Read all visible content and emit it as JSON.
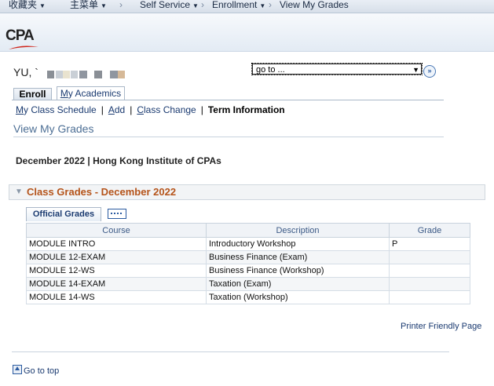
{
  "topnav": {
    "favorites": "收藏夹",
    "main_menu": "主菜单",
    "self_service": "Self Service",
    "enrollment": "Enrollment",
    "current": "View My Grades"
  },
  "header": {
    "logo": "CPA",
    "logo_color": "#222222",
    "swoosh_color": "#d0271d"
  },
  "student": {
    "name": "YU, `"
  },
  "goto": {
    "value": "go to ..."
  },
  "tabs": {
    "enroll": "Enroll",
    "academics_prefix": "M",
    "academics_rest": "y Academics"
  },
  "sublinks": {
    "schedule_u": "M",
    "schedule_rest": "y Class Schedule",
    "add_u": "A",
    "add_rest": "dd",
    "change_u": "C",
    "change_rest": "lass Change",
    "term_info": "Term Information",
    "bar": "|"
  },
  "page": {
    "title": "View My Grades",
    "term": "December 2022 | Hong Kong Institute of CPAs"
  },
  "section": {
    "title": "Class Grades - December 2022",
    "title_color": "#b5541b"
  },
  "grid": {
    "tab": "Official Grades",
    "headers": [
      "Course",
      "Description",
      "Grade"
    ],
    "rows": [
      [
        "MODULE INTRO",
        "Introductory Workshop",
        "P"
      ],
      [
        "MODULE 12-EXAM",
        "Business Finance (Exam)",
        ""
      ],
      [
        "MODULE 12-WS",
        "Business Finance (Workshop)",
        ""
      ],
      [
        "MODULE 14-EXAM",
        "Taxation (Exam)",
        ""
      ],
      [
        "MODULE 14-WS",
        "Taxation (Workshop)",
        ""
      ]
    ]
  },
  "footer": {
    "printer": "Printer Friendly Page",
    "go_top": "Go to top"
  }
}
